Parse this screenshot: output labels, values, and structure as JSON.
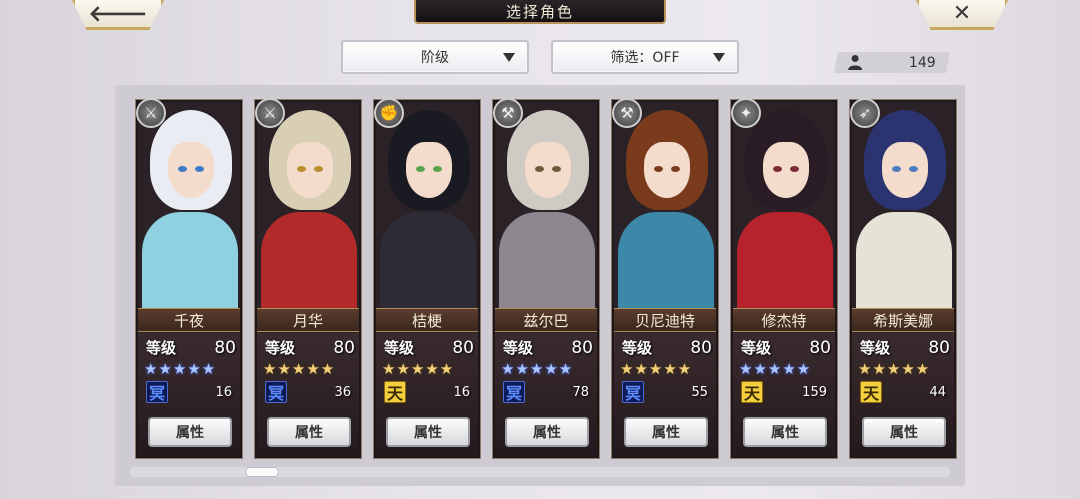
{
  "header": {
    "title": "选择角色",
    "back_glyph": "🡐",
    "close_glyph": "✕"
  },
  "filters": {
    "rank_label": "阶级",
    "filter_label": "筛选：OFF"
  },
  "owned_count": "149",
  "characters": [
    {
      "name": "千夜",
      "level_label": "等级",
      "level": "80",
      "stars": "★★★★★",
      "star_color": "blue",
      "badge": "冥",
      "badge_type": "ming",
      "count": "16",
      "attr_label": "属性",
      "class_icon": "blade-icon",
      "hair": "#e9ecf2",
      "body": "#8fd1e0",
      "eye": "#3d79c6"
    },
    {
      "name": "月华",
      "level_label": "等级",
      "level": "80",
      "stars": "★★★★★",
      "star_color": "gold",
      "badge": "冥",
      "badge_type": "ming",
      "count": "36",
      "attr_label": "属性",
      "class_icon": "blade-icon",
      "hair": "#d8cfb4",
      "body": "#b32a2a",
      "eye": "#b98d2b"
    },
    {
      "name": "桔梗",
      "level_label": "等级",
      "level": "80",
      "stars": "★★★★★",
      "star_color": "gold",
      "badge": "天",
      "badge_type": "tian",
      "count": "16",
      "attr_label": "属性",
      "class_icon": "fist-icon",
      "hair": "#1a1a22",
      "body": "#2d2b36",
      "eye": "#5aa34a"
    },
    {
      "name": "兹尔巴",
      "level_label": "等级",
      "level": "80",
      "stars": "★★★★★",
      "star_color": "blue",
      "badge": "冥",
      "badge_type": "ming",
      "count": "78",
      "attr_label": "属性",
      "class_icon": "axe-icon",
      "hair": "#cfcbc4",
      "body": "#8d8790",
      "eye": "#6d5a3a"
    },
    {
      "name": "贝尼迪特",
      "level_label": "等级",
      "level": "80",
      "stars": "★★★★★",
      "star_color": "gold",
      "badge": "冥",
      "badge_type": "ming",
      "count": "55",
      "attr_label": "属性",
      "class_icon": "axe-icon",
      "hair": "#7a3b1c",
      "body": "#3b88a8",
      "eye": "#7a3b1c"
    },
    {
      "name": "修杰特",
      "level_label": "等级",
      "level": "80",
      "stars": "★★★★★",
      "star_color": "blue",
      "badge": "天",
      "badge_type": "tian",
      "count": "159",
      "attr_label": "属性",
      "class_icon": "staff-icon",
      "hair": "#2a1c25",
      "body": "#b7232d",
      "eye": "#7b2a36"
    },
    {
      "name": "希斯美娜",
      "level_label": "等级",
      "level": "80",
      "stars": "★★★★★",
      "star_color": "gold",
      "badge": "天",
      "badge_type": "tian",
      "count": "44",
      "attr_label": "属性",
      "class_icon": "spear-icon",
      "hair": "#2b3470",
      "body": "#e7e2d6",
      "eye": "#4c7cc1"
    }
  ],
  "scroll_position": 0.14
}
